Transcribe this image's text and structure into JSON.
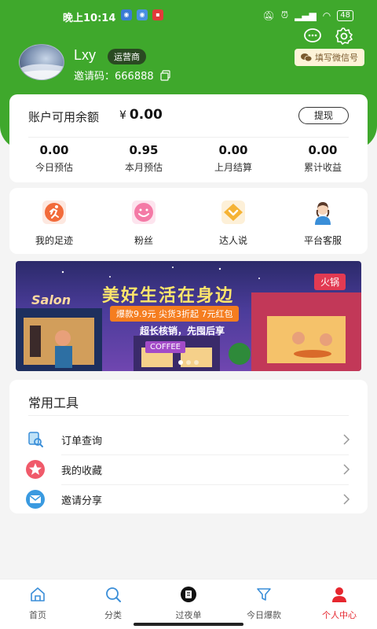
{
  "status_bar": {
    "time": "晚上10:14",
    "battery": "48",
    "apps": [
      {
        "icon": "app-icon-blue",
        "color": "#3a7bd5"
      },
      {
        "icon": "app-icon-blue2",
        "color": "#4a90e2"
      },
      {
        "icon": "app-icon-red",
        "color": "#e23a3a"
      }
    ]
  },
  "header": {
    "username": "Lxy",
    "role": "运营商",
    "invite_code": "邀请码：666888",
    "wechat_button": "填写微信号"
  },
  "balance": {
    "label": "账户可用余额",
    "currency": "¥",
    "amount": "0.00",
    "withdraw": "提现",
    "stats": [
      {
        "value": "0.00",
        "label": "今日预估"
      },
      {
        "value": "0.95",
        "label": "本月预估"
      },
      {
        "value": "0.00",
        "label": "上月结算"
      },
      {
        "value": "0.00",
        "label": "累计收益"
      }
    ]
  },
  "shortcuts": [
    {
      "label": "我的足迹",
      "icon": "running-icon",
      "color": "#f26b3a"
    },
    {
      "label": "粉丝",
      "icon": "smile-icon",
      "color": "#f47aa6"
    },
    {
      "label": "达人说",
      "icon": "heart-chat-icon",
      "color": "#f5b335"
    },
    {
      "label": "平台客服",
      "icon": "customer-service-icon",
      "color": "#3a8ed8"
    }
  ],
  "banner": {
    "title": "美好生活在身边",
    "subtitle": "爆款9.9元  尖货3折起  7元红包",
    "slogan": "超长核销，先囤后享",
    "salon": "Salon",
    "hotpot": "火锅",
    "coffee": "COFFEE"
  },
  "tools": {
    "title": "常用工具",
    "items": [
      {
        "label": "订单查询",
        "icon": "order-search-icon"
      },
      {
        "label": "我的收藏",
        "icon": "star-icon"
      },
      {
        "label": "邀请分享",
        "icon": "mail-icon"
      }
    ]
  },
  "tabbar": [
    {
      "label": "首页",
      "icon": "home-icon",
      "active": false
    },
    {
      "label": "分类",
      "icon": "search-icon",
      "active": false
    },
    {
      "label": "过夜单",
      "icon": "night-order-icon",
      "active": false
    },
    {
      "label": "今日爆款",
      "icon": "filter-icon",
      "active": false
    },
    {
      "label": "个人中心",
      "icon": "user-icon",
      "active": true
    }
  ],
  "colors": {
    "brand_green": "#3fa82c",
    "active_tab": "#e6262e"
  }
}
